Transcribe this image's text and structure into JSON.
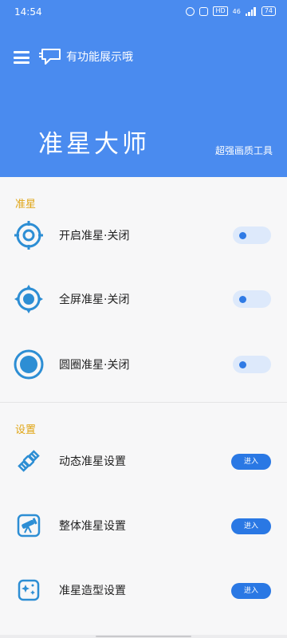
{
  "status_bar": {
    "time": "14:54",
    "signal": "46",
    "battery": "74"
  },
  "header": {
    "brand_text": "有功能展示哦",
    "title": "准星大师",
    "subtitle": "超强画质工具"
  },
  "crosshair_section": {
    "label": "准星",
    "rows": [
      {
        "label": "开启准星·关闭",
        "toggle_on": false
      },
      {
        "label": "全屏准星·关闭",
        "toggle_on": false
      },
      {
        "label": "圆圈准星·关闭",
        "toggle_on": false
      }
    ]
  },
  "settings_section": {
    "label": "设置",
    "rows": [
      {
        "label": "动态准星设置",
        "button": "进入"
      },
      {
        "label": "整体准星设置",
        "button": "进入"
      },
      {
        "label": "准星造型设置",
        "button": "进入"
      }
    ]
  },
  "icons": {
    "menu": "menu-icon",
    "brand": "speech-bubble-icon",
    "row1": "crosshair-target-icon",
    "row2": "crosshair-fullscreen-icon",
    "row3": "crosshair-circle-icon",
    "row4": "satellite-icon",
    "row5": "telescope-icon",
    "row6": "sparkle-box-icon"
  },
  "colors": {
    "header_bg": "#4a8bef",
    "accent": "#2a78e4",
    "section_label": "#e0a514",
    "icon": "#2d8ed4"
  }
}
